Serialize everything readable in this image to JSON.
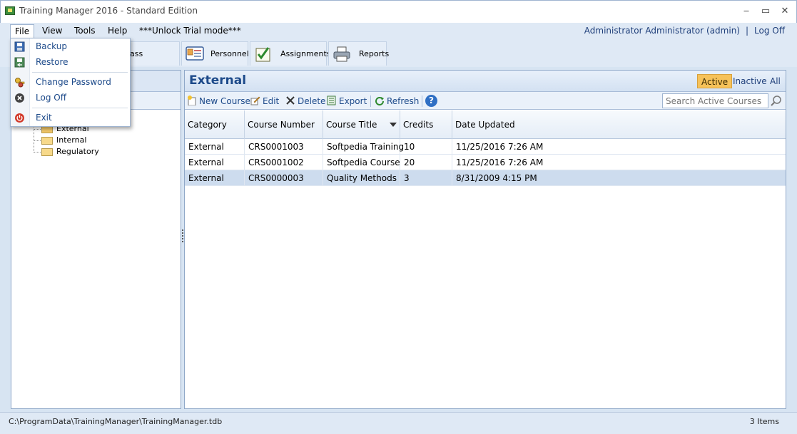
{
  "window": {
    "title": "Training Manager 2016 - Standard Edition",
    "min_glyph": "‒",
    "max_glyph": "▭",
    "close_glyph": "✕"
  },
  "menu": {
    "items": [
      "File",
      "View",
      "Tools",
      "Help"
    ],
    "trial": "***Unlock Trial mode***",
    "open_menu": "File"
  },
  "user": {
    "name": "Administrator Administrator (admin)",
    "separator": "|",
    "logoff": "Log Off"
  },
  "toolbar": {
    "buttons": [
      {
        "label": "lass Sessions",
        "icon": "calendar-icon"
      },
      {
        "label": "Personnel",
        "icon": "personnel-card-icon"
      },
      {
        "label": "Assignments",
        "icon": "checklist-icon"
      },
      {
        "label": "Reports",
        "icon": "printer-icon"
      }
    ]
  },
  "file_menu": {
    "items": [
      {
        "label": "Backup",
        "icon": "save-disk-icon"
      },
      {
        "label": "Restore",
        "icon": "restore-disk-icon"
      },
      {
        "label": "Change Password",
        "icon": "keys-icon"
      },
      {
        "label": "Log Off",
        "icon": "logoff-icon"
      },
      {
        "label": "Exit",
        "icon": "power-icon"
      }
    ]
  },
  "tree": {
    "items": [
      "External",
      "Internal",
      "Regulatory"
    ]
  },
  "main": {
    "title": "External",
    "filters": [
      "Active",
      "Inactive",
      "All"
    ],
    "active_filter": "Active",
    "actions": {
      "new": "New Course",
      "edit": "Edit",
      "delete": "Delete",
      "export": "Export",
      "refresh": "Refresh",
      "help": "?"
    },
    "search_placeholder": "Search Active Courses",
    "columns": [
      "Category",
      "Course Number",
      "Course Title",
      "Credits",
      "Date Updated"
    ],
    "rows": [
      {
        "category": "External",
        "number": "CRS0001003",
        "title": "Softpedia Training",
        "credits": "10",
        "updated": "11/25/2016 7:26 AM"
      },
      {
        "category": "External",
        "number": "CRS0001002",
        "title": "Softpedia Course",
        "credits": "20",
        "updated": "11/25/2016 7:26 AM"
      },
      {
        "category": "External",
        "number": "CRS0000003",
        "title": "Quality Methods",
        "credits": "3",
        "updated": "8/31/2009 4:15 PM"
      }
    ],
    "selected_row": 2
  },
  "status": {
    "path": "C:\\ProgramData\\TrainingManager\\TrainingManager.tdb",
    "count": "3 Items"
  },
  "colors": {
    "accent": "#1d4a8a",
    "active_filter": "#f6c25a",
    "selected_row": "#cddcee"
  }
}
